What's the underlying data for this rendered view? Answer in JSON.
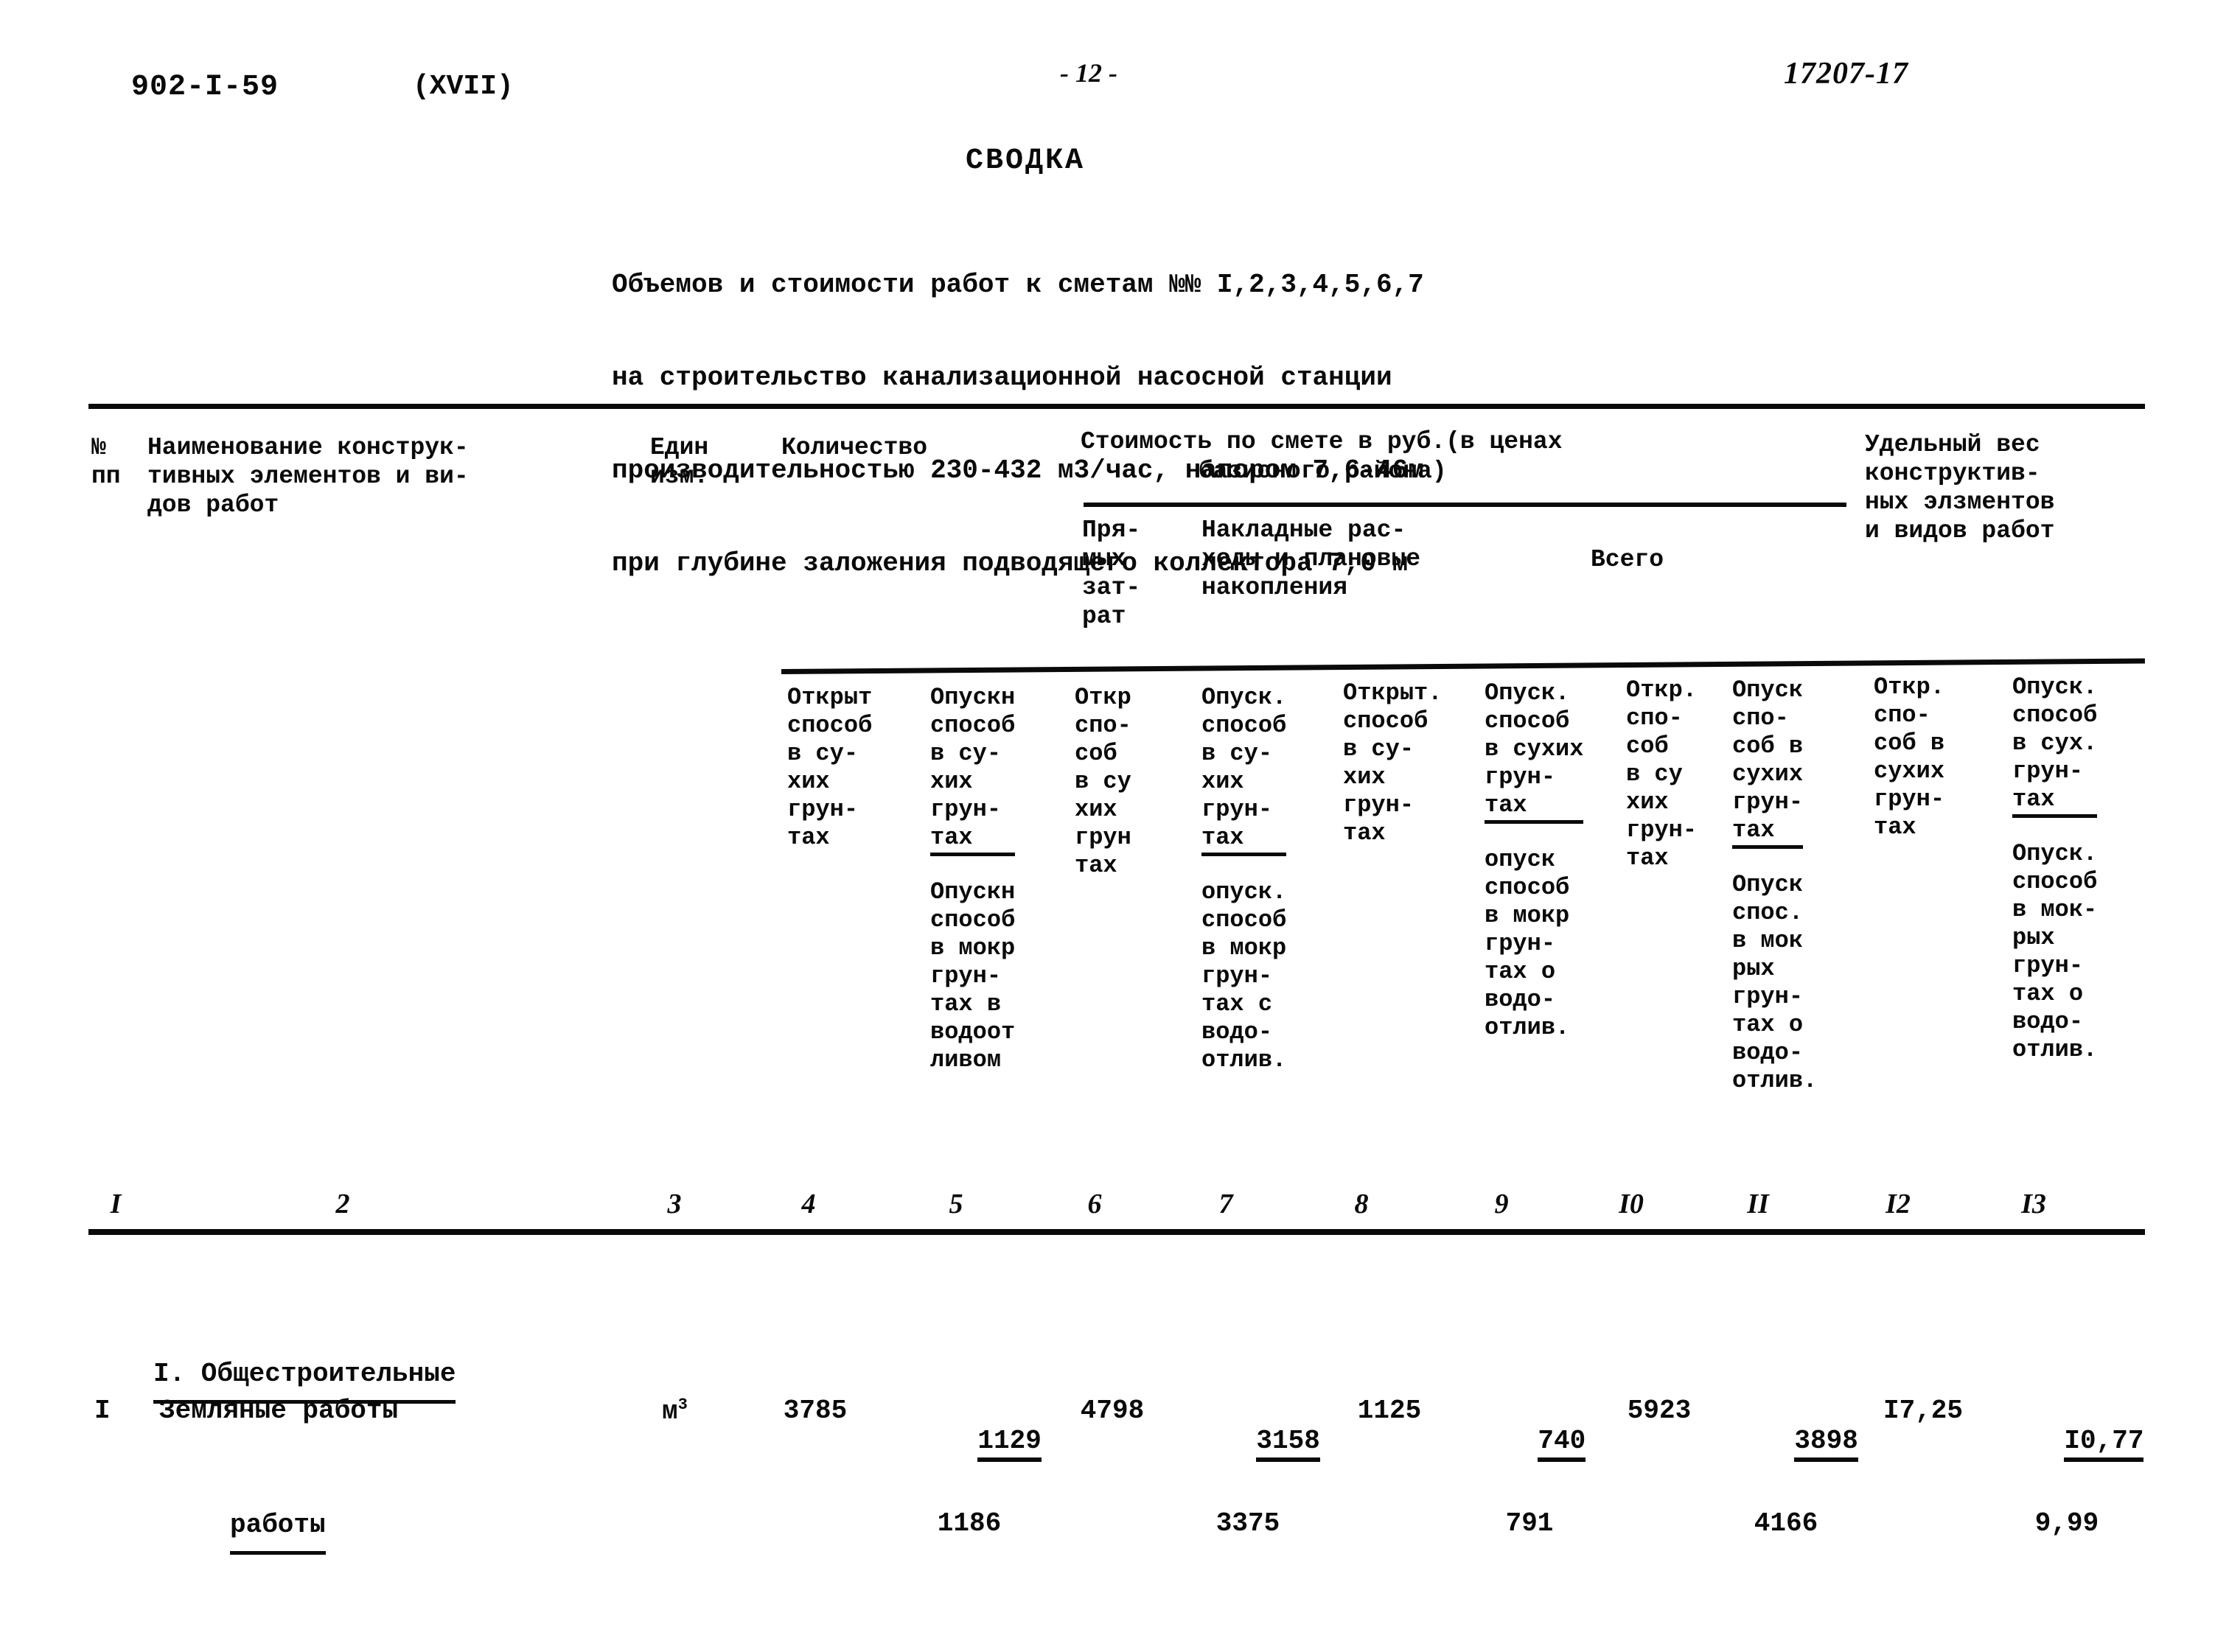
{
  "header": {
    "doc_code": "902-I-59",
    "doc_variant": "(XVII)",
    "page_number": "- 12 -",
    "sheet_code": "17207-17"
  },
  "title": "СВОДКА",
  "subtitle_lines": [
    "Объемов и стоимости работ к сметам №№ I,2,3,4,5,6,7",
    "на строительство канализационной насосной станции",
    "производительностью 230-432 м3/час, напором 7,6-46м",
    "при глубине заложения подводящего коллектора 7,0 м"
  ],
  "table": {
    "headers": {
      "num_line1": "№",
      "num_line2": "пп",
      "name": "Наименование конструк-\nтивных элементов и ви-\nдов работ",
      "unit": "Един\nизм.",
      "quantity": "Количество",
      "cost_group_line1": "Стоимость по смете в руб.(в ценах",
      "cost_group_line2": "базисного района)",
      "direct": "Пря-\nмых\nзат-\nрат",
      "overhead": "Накладные рас-\nходы и плановые\nнакопления",
      "total": "Всего",
      "weight": "Удельный вес\nконструктив-\nных элзментов\nи видов работ"
    },
    "subheaders": [
      {
        "col": "4",
        "top": "Открыт\nспособ\nв су-\nхих\nгрун-\nтах",
        "top_underline": false,
        "bottom": ""
      },
      {
        "col": "5",
        "top": "Опускн\nспособ\nв су-\nхих\nгрун-\nтах",
        "top_underline": true,
        "bottom": "Опускн\nспособ\nв мокр\nгрун-\nтах в\nводоот\nливом"
      },
      {
        "col": "6",
        "top": "Откр\nспо-\nсоб\nв су\nхих\nгрун\nтах",
        "top_underline": false,
        "bottom": ""
      },
      {
        "col": "7",
        "top": "Опуск.\nспособ\nв су-\nхих\nгрун-\nтах",
        "top_underline": true,
        "bottom": "опуск.\nспособ\nв мокр\nгрун-\nтах с\nводо-\nотлив."
      },
      {
        "col": "8",
        "top": "Открыт.\nспособ\nв су-\nхих\nгрун-\nтах",
        "top_underline": false,
        "bottom": ""
      },
      {
        "col": "9",
        "top": "Опуск.\nспособ\nв сухих\nгрун-\nтах",
        "top_underline": true,
        "bottom": "опуск\nспособ\nв мокр\nгрун-\nтах о\nводо-\nотлив."
      },
      {
        "col": "10",
        "top": "Откр.\nспо-\nсоб\nв су\nхих\nгрун-\nтах",
        "top_underline": false,
        "bottom": ""
      },
      {
        "col": "11",
        "top": "Опуск\nспо-\nсоб в\nсухих\nгрун-\nтах",
        "top_underline": true,
        "bottom": "Опуск\nспос.\nв мок\nрых\nгрун-\nтах о\nводо-\nотлив."
      },
      {
        "col": "12",
        "top": "Откр.\nспо-\nсоб в\nсухих\nгрун-\nтах",
        "top_underline": false,
        "bottom": ""
      },
      {
        "col": "13",
        "top": "Опуск.\nспособ\nв сух.\nгрун-\nтах",
        "top_underline": true,
        "bottom": "Опуск.\nспособ\nв мок-\nрых\nгрун-\nтах о\nводо-\nотлив."
      }
    ],
    "column_numbers": [
      "I",
      "2",
      "3",
      "4",
      "5",
      "6",
      "7",
      "8",
      "9",
      "I0",
      "II",
      "I2",
      "I3"
    ],
    "section": {
      "label_line1": "I. Общестроительные",
      "label_line2": "работы"
    },
    "rows": [
      {
        "num": "I",
        "name": "Земляные работы",
        "unit_base": "м",
        "unit_sup": "3",
        "c4": "3785",
        "c5_top": "1129",
        "c5_bottom": "1186",
        "c6": "4798",
        "c7_top": "3158",
        "c7_bottom": "3375",
        "c8": "1125",
        "c9_top": "740",
        "c9_bottom": "791",
        "c10": "5923",
        "c11_top": "3898",
        "c11_bottom": "4166",
        "c12": "I7,25",
        "c13_top": "I0,77",
        "c13_bottom": "9,99"
      }
    ]
  }
}
